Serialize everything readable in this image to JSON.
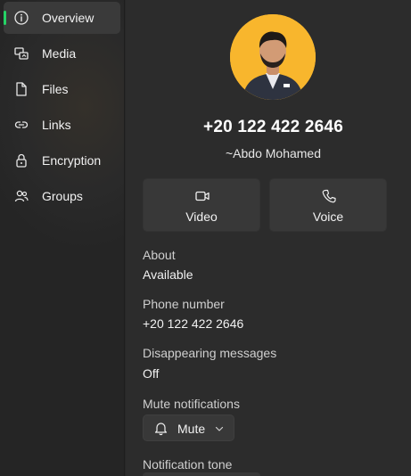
{
  "sidebar": {
    "items": [
      {
        "label": "Overview",
        "icon": "info-icon",
        "active": true
      },
      {
        "label": "Media",
        "icon": "media-icon",
        "active": false
      },
      {
        "label": "Files",
        "icon": "file-icon",
        "active": false
      },
      {
        "label": "Links",
        "icon": "link-icon",
        "active": false
      },
      {
        "label": "Encryption",
        "icon": "lock-icon",
        "active": false
      },
      {
        "label": "Groups",
        "icon": "groups-icon",
        "active": false
      }
    ]
  },
  "contact": {
    "phone": "+20 122 422 2646",
    "name": "~Abdo Mohamed",
    "avatar_bg": "#f8b62d"
  },
  "actions": {
    "video_label": "Video",
    "voice_label": "Voice"
  },
  "details": {
    "about_label": "About",
    "about_value": "Available",
    "phone_label": "Phone number",
    "phone_value": "+20 122 422 2646",
    "disappearing_label": "Disappearing messages",
    "disappearing_value": "Off",
    "mute_label": "Mute notifications",
    "mute_button": "Mute",
    "tone_label": "Notification tone"
  },
  "colors": {
    "accent": "#25d366",
    "background": "#2c2c2c",
    "sidebar": "#272727"
  }
}
